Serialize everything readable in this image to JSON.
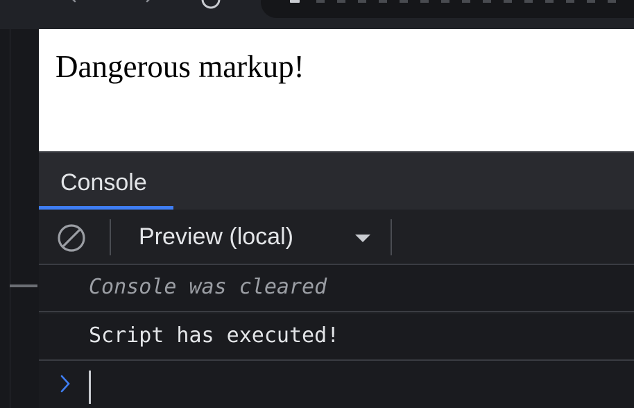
{
  "page": {
    "heading": "Dangerous markup!"
  },
  "devtools": {
    "tabs": [
      {
        "label": "Console",
        "active": true
      }
    ],
    "toolbar": {
      "context_select": {
        "selected": "Preview (local)"
      }
    },
    "messages": [
      {
        "text": "Console was cleared",
        "kind": "info-cleared"
      },
      {
        "text": "Script has executed!",
        "kind": "log"
      }
    ],
    "prompt": {
      "value": ""
    }
  },
  "colors": {
    "accent": "#3f7ef3",
    "panel_bg": "#1f2024",
    "tabbar_bg": "#292a2f",
    "text": "#e3e5e8",
    "muted_text": "#9b9ea4"
  }
}
